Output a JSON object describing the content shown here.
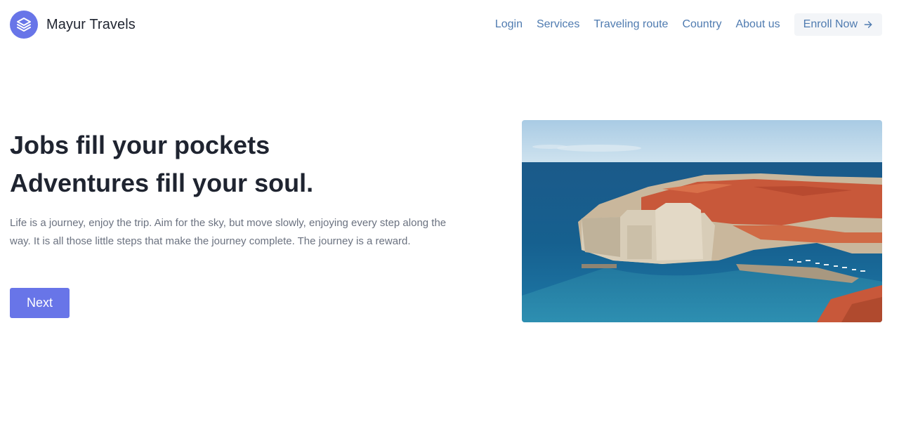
{
  "brand": {
    "name": "Mayur Travels",
    "logo_icon": "layers-icon",
    "accent": "#6875e8"
  },
  "nav": {
    "links": [
      "Login",
      "Services",
      "Traveling route",
      "Country",
      "About us"
    ],
    "cta_label": "Enroll Now",
    "cta_icon": "arrow-right-icon"
  },
  "hero": {
    "headline_line1": "Jobs fill your pockets",
    "headline_line2": "Adventures fill your soul.",
    "description": "Life is a journey, enjoy the trip. Aim for the sky, but move slowly, enjoying every step along the way. It is all those little steps that make the journey complete. The journey is a reward.",
    "button_label": "Next",
    "image_subject": "coastal-walled-old-town"
  }
}
